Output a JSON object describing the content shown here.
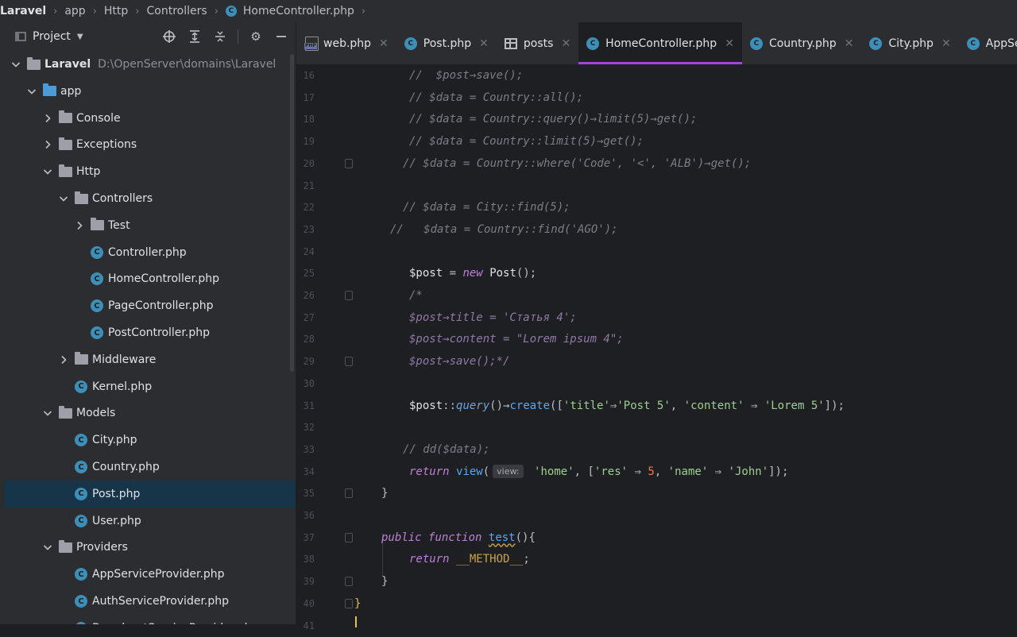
{
  "breadcrumb": [
    "Laravel",
    "app",
    "Http",
    "Controllers",
    "HomeController.php"
  ],
  "project_panel": {
    "title": "Project",
    "tree": [
      {
        "label": "Laravel",
        "path": "D:\\OpenServer\\domains\\Laravel",
        "kind": "folder",
        "level": 0,
        "state": "open",
        "root": true
      },
      {
        "label": "app",
        "kind": "folder-blue",
        "level": 1,
        "state": "open"
      },
      {
        "label": "Console",
        "kind": "folder",
        "level": 2,
        "state": "closed"
      },
      {
        "label": "Exceptions",
        "kind": "folder",
        "level": 2,
        "state": "closed"
      },
      {
        "label": "Http",
        "kind": "folder",
        "level": 2,
        "state": "open"
      },
      {
        "label": "Controllers",
        "kind": "folder",
        "level": 3,
        "state": "open"
      },
      {
        "label": "Test",
        "kind": "folder",
        "level": 4,
        "state": "closed"
      },
      {
        "label": "Controller.php",
        "kind": "class",
        "level": 4
      },
      {
        "label": "HomeController.php",
        "kind": "class",
        "level": 4
      },
      {
        "label": "PageController.php",
        "kind": "class",
        "level": 4
      },
      {
        "label": "PostController.php",
        "kind": "class",
        "level": 4
      },
      {
        "label": "Middleware",
        "kind": "folder",
        "level": 3,
        "state": "closed"
      },
      {
        "label": "Kernel.php",
        "kind": "class",
        "level": 3
      },
      {
        "label": "Models",
        "kind": "folder",
        "level": 2,
        "state": "open"
      },
      {
        "label": "City.php",
        "kind": "class",
        "level": 3
      },
      {
        "label": "Country.php",
        "kind": "class",
        "level": 3
      },
      {
        "label": "Post.php",
        "kind": "class",
        "level": 3,
        "selected": true
      },
      {
        "label": "User.php",
        "kind": "class",
        "level": 3
      },
      {
        "label": "Providers",
        "kind": "folder",
        "level": 2,
        "state": "open"
      },
      {
        "label": "AppServiceProvider.php",
        "kind": "class",
        "level": 3
      },
      {
        "label": "AuthServiceProvider.php",
        "kind": "class",
        "level": 3
      },
      {
        "label": "BroadcastServiceProvider.php",
        "kind": "class",
        "level": 3
      }
    ]
  },
  "tabs": [
    {
      "label": "web.php",
      "icon": "php-file-icon",
      "active": false
    },
    {
      "label": "Post.php",
      "icon": "class-c-icon",
      "active": false
    },
    {
      "label": "posts",
      "icon": "table-icon",
      "active": false
    },
    {
      "label": "HomeController.php",
      "icon": "class-c-icon",
      "active": true
    },
    {
      "label": "Country.php",
      "icon": "class-c-icon",
      "active": false
    },
    {
      "label": "City.php",
      "icon": "class-c-icon",
      "active": false
    },
    {
      "label": "AppServiceProvider.php",
      "icon": "class-c-icon",
      "active": false,
      "truncated": true
    }
  ],
  "code": {
    "inlay_hint": "view:",
    "lines": [
      {
        "n": "16",
        "fold": false,
        "text": "//  $post→save();"
      },
      {
        "n": "17",
        "fold": false,
        "text": "// $data = Country::all();"
      },
      {
        "n": "18",
        "fold": false,
        "text": "// $data = Country::query()→limit(5)→get();"
      },
      {
        "n": "19",
        "fold": false,
        "text": "// $data = Country::limit(5)→get();"
      },
      {
        "n": "20",
        "fold": true,
        "text": "// $data = Country::where('Code', '<', 'ALB')→get();"
      },
      {
        "n": "21",
        "fold": false,
        "text": ""
      },
      {
        "n": "22",
        "fold": false,
        "text": "// $data = City::find(5);"
      },
      {
        "n": "23",
        "fold": false,
        "text": "//   $data = Country::find('AGO');"
      },
      {
        "n": "24",
        "fold": false,
        "text": ""
      },
      {
        "n": "25",
        "fold": false,
        "text": "$post = new Post();"
      },
      {
        "n": "26",
        "fold": true,
        "text": "/*"
      },
      {
        "n": "27",
        "fold": false,
        "text": "$post→title = 'Статья 4';"
      },
      {
        "n": "28",
        "fold": false,
        "text": "$post→content = \"Lorem ipsum 4\";"
      },
      {
        "n": "29",
        "fold": true,
        "text": "$post→save();*/"
      },
      {
        "n": "30",
        "fold": false,
        "text": ""
      },
      {
        "n": "31",
        "fold": false,
        "text": "$post::query()→create(['title'⇒'Post 5', 'content' ⇒ 'Lorem 5']);"
      },
      {
        "n": "32",
        "fold": false,
        "text": ""
      },
      {
        "n": "33",
        "fold": false,
        "text": "// dd($data);"
      },
      {
        "n": "34",
        "fold": false,
        "text": "return view( 'home', ['res' ⇒ 5, 'name' ⇒ 'John']);"
      },
      {
        "n": "35",
        "fold": true,
        "text": "}"
      },
      {
        "n": "36",
        "fold": false,
        "text": ""
      },
      {
        "n": "37",
        "fold": true,
        "text": "public function test(){"
      },
      {
        "n": "38",
        "fold": false,
        "text": "return __METHOD__;"
      },
      {
        "n": "39",
        "fold": true,
        "text": "}"
      },
      {
        "n": "40",
        "fold": true,
        "text": "}"
      },
      {
        "n": "41",
        "fold": false,
        "text": ""
      }
    ]
  }
}
